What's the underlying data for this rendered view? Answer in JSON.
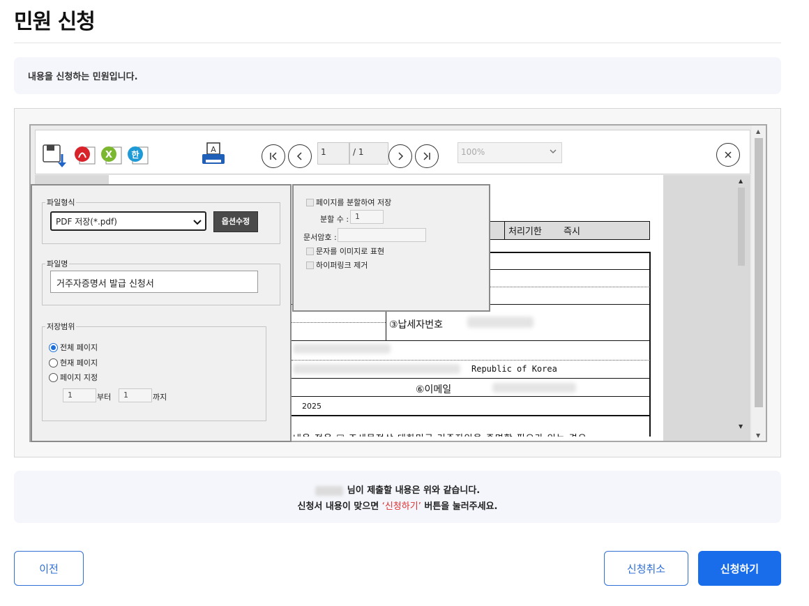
{
  "page": {
    "title": "민원 신청",
    "info_text": "내용을 신청하는 민원입니다."
  },
  "viewer": {
    "toolbar": {
      "page_current": "1",
      "page_total": "/ 1",
      "zoom": "100%"
    },
    "save_dialog": {
      "file_format_legend": "파일형식",
      "file_format_value": "PDF 저장(*.pdf)",
      "options_button": "옵션수정",
      "file_name_legend": "파일명",
      "file_name_value": "거주자증명서 발급 신청서",
      "save_range_legend": "저장범위",
      "range_all": "전체 페이지",
      "range_current": "현재 페이지",
      "range_custom": "페이지 지정",
      "range_from_value": "1",
      "range_from_suffix": "부터",
      "range_to_value": "1",
      "range_to_suffix": "까지"
    },
    "options_panel": {
      "split_pages": "페이지를 분할하여 저장",
      "split_count_label": "분할 수 :",
      "split_count_value": "1",
      "doc_password_label": "문서암호 :",
      "text_as_image": "문자를 이미지로 표현",
      "remove_hyperlinks": "하이퍼링크 제거"
    },
    "document": {
      "processing_label": "처리기한",
      "processing_value": "즉시",
      "taxpayer_no_label": "③납세자번호",
      "country": "Republic of Korea",
      "email_label": "⑥이메일",
      "year": "2025",
      "bottom_text": "내용 적용 ☑ 조세목적상 대한민국 거주자임을 증명할 필요가 있는 경우"
    }
  },
  "summary": {
    "line1_suffix": "님이 제출할 내용은 위와 같습니다.",
    "line2_prefix": "신청서 내용이 맞으면 ",
    "line2_accent": "‘신청하기’",
    "line2_suffix": " 버튼을 눌러주세요."
  },
  "buttons": {
    "prev": "이전",
    "cancel": "신청취소",
    "submit": "신청하기"
  },
  "colors": {
    "primary": "#1a6dea",
    "accent_red": "#e03131",
    "info_bg": "#f4f6fb"
  }
}
